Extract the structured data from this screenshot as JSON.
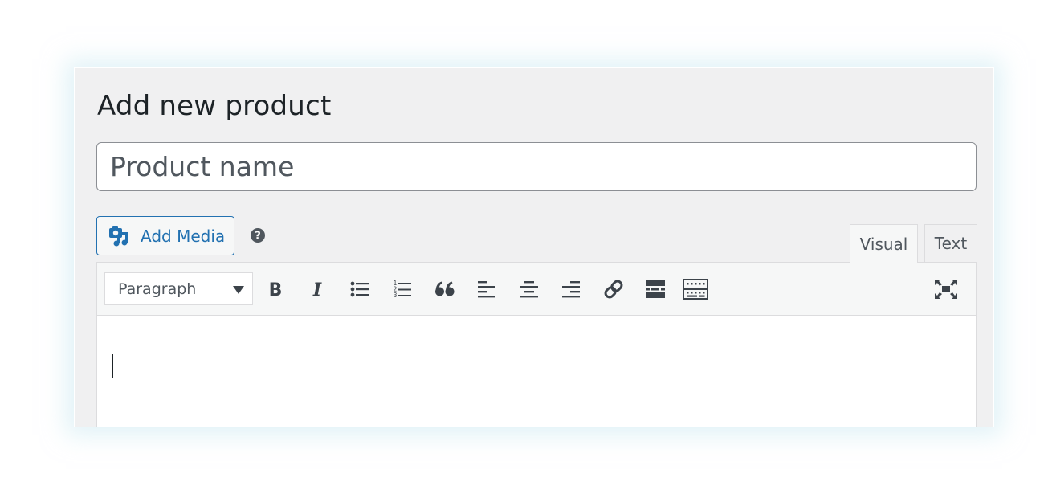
{
  "page": {
    "title": "Add new product"
  },
  "title_field": {
    "placeholder": "Product name",
    "value": ""
  },
  "media": {
    "add_media_label": "Add Media",
    "add_media_icon": "camera-music-icon",
    "help_icon": "question-circle-icon"
  },
  "editor_tabs": [
    {
      "label": "Visual",
      "active": true
    },
    {
      "label": "Text",
      "active": false
    }
  ],
  "toolbar": {
    "format_select": {
      "selected": "Paragraph"
    },
    "buttons": [
      {
        "name": "bold",
        "icon": "bold-icon"
      },
      {
        "name": "italic",
        "icon": "italic-icon"
      },
      {
        "name": "bulleted-list",
        "icon": "bullet-list-icon"
      },
      {
        "name": "numbered-list",
        "icon": "numbered-list-icon"
      },
      {
        "name": "blockquote",
        "icon": "quote-icon"
      },
      {
        "name": "align-left",
        "icon": "align-left-icon"
      },
      {
        "name": "align-center",
        "icon": "align-center-icon"
      },
      {
        "name": "align-right",
        "icon": "align-right-icon"
      },
      {
        "name": "insert-link",
        "icon": "link-icon"
      },
      {
        "name": "read-more",
        "icon": "read-more-icon"
      },
      {
        "name": "toolbar-toggle",
        "icon": "keyboard-icon"
      },
      {
        "name": "fullscreen",
        "icon": "fullscreen-icon"
      }
    ]
  },
  "colors": {
    "accent": "#2271b1",
    "icon": "#3c434a",
    "panel_bg": "#f0f0f1",
    "text": "#1d2327"
  },
  "editor": {
    "content": ""
  }
}
